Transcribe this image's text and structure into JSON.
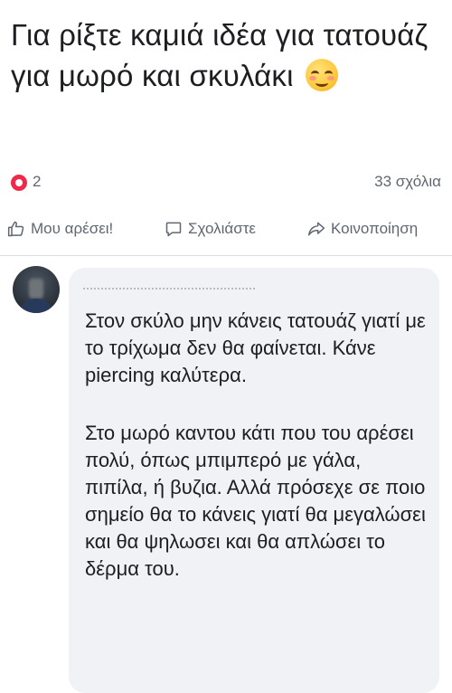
{
  "post": {
    "text": "Για ρίξτε καμιά ιδέα για τατουάζ για μωρό και σκυλάκι",
    "emoji_icon": "smiling-blush-emoji"
  },
  "stats": {
    "reaction_icon": "love-reaction-icon",
    "reaction_color": "#f02849",
    "reactions": "2",
    "comments": "33 σχόλια"
  },
  "actions": {
    "like": "Μου αρέσει!",
    "comment": "Σχολιάστε",
    "share": "Κοινοποίηση"
  },
  "comment": {
    "paragraphs": [
      "Στον σκύλο μην κάνεις τατουάζ γιατί με το τρίχωμα δεν θα φαίνεται. Κάνε piercing καλύτερα.",
      "Στο μωρό καντου κάτι που του αρέσει πολύ, όπως μπιμπερό με γάλα, πιπίλα, ή βυζια. Αλλά πρόσεχε σε ποιο σημείο θα το κάνεις γιατί θα μεγαλώσει και θα ψηλωσει και θα απλώσει το δέρμα του."
    ]
  }
}
